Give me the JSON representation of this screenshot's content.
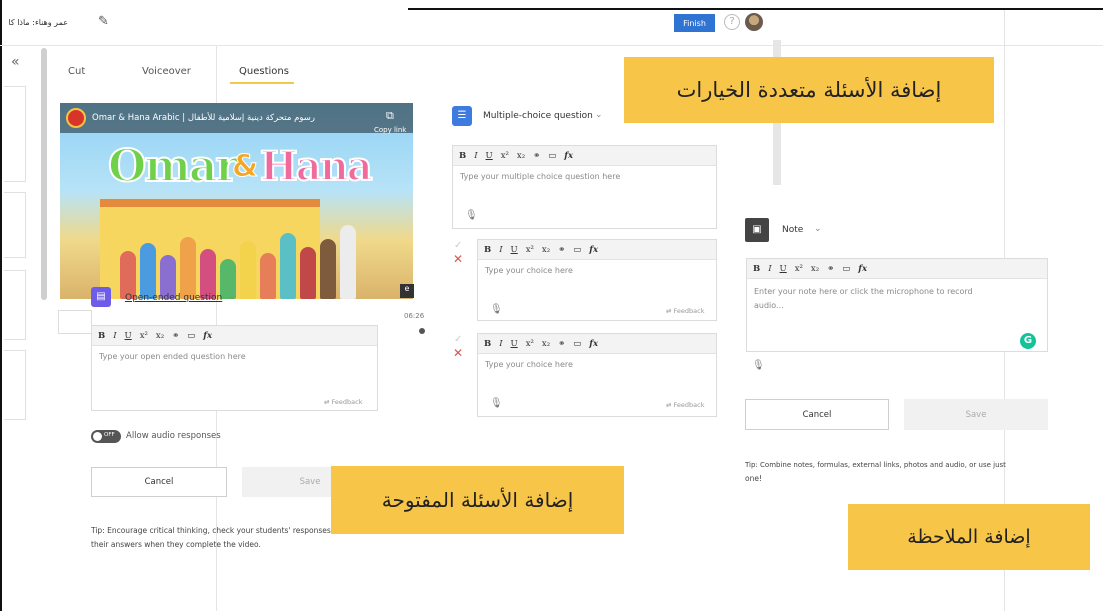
{
  "header": {
    "lesson_title": "عمر وهناء: ماذا كان",
    "edit_icon": "pencil-icon",
    "finish_label": "Finish",
    "help_icon": "question-circle-icon"
  },
  "tabs": [
    {
      "label": "Cut"
    },
    {
      "label": "Voiceover"
    },
    {
      "label": "Questions"
    }
  ],
  "video": {
    "title": "Omar & Hana Arabic | رسوم متحركة دينية إسلامية للأطفال",
    "copy_label": "Copy link",
    "brand_left": "Omar",
    "brand_right": "Hana",
    "duration": "06:26"
  },
  "open_question": {
    "type_label": "Open-ended question",
    "placeholder": "Type your open ended question here",
    "feedback": "Feedback",
    "toggle_state": "OFF",
    "toggle_label": "Allow audio responses",
    "cancel": "Cancel",
    "save": "Save",
    "tip_line1": "Tip: Encourage critical thinking, check your students' responses",
    "tip_line2": "their answers when they complete the video."
  },
  "mc_question": {
    "type_label": "Multiple-choice question",
    "placeholder": "Type your multiple choice question here",
    "choices": [
      {
        "placeholder": "Type your choice here",
        "feedback": "Feedback"
      },
      {
        "placeholder": "Type your choice here",
        "feedback": "Feedback"
      }
    ]
  },
  "note": {
    "type_label": "Note",
    "placeholder_line1": "Enter your note here or click the microphone to record",
    "placeholder_line2": "audio...",
    "cancel": "Cancel",
    "save": "Save",
    "tip_line1": "Tip: Combine notes, formulas, external links, photos and audio, or use just",
    "tip_line2": "one!"
  },
  "toolbar": {
    "bold": "B",
    "italic": "I",
    "underline": "U",
    "superscript": "x²",
    "subscript": "x₂",
    "link": "⚭",
    "image": "▭",
    "formula": "fx"
  },
  "callouts": {
    "multiple_choice": "إضافة الأسئلة متعددة الخيارات",
    "open_ended": "إضافة الأسئلة المفتوحة",
    "note": "إضافة الملاحظة"
  },
  "colors": {
    "accent_blue": "#2f73d3",
    "callout_yellow": "#f7c548",
    "open_icon_purple": "#6c5ce7",
    "mc_icon_blue": "#3d7be0",
    "grammarly_green": "#15c39a",
    "wrong_red": "#d9534f"
  }
}
